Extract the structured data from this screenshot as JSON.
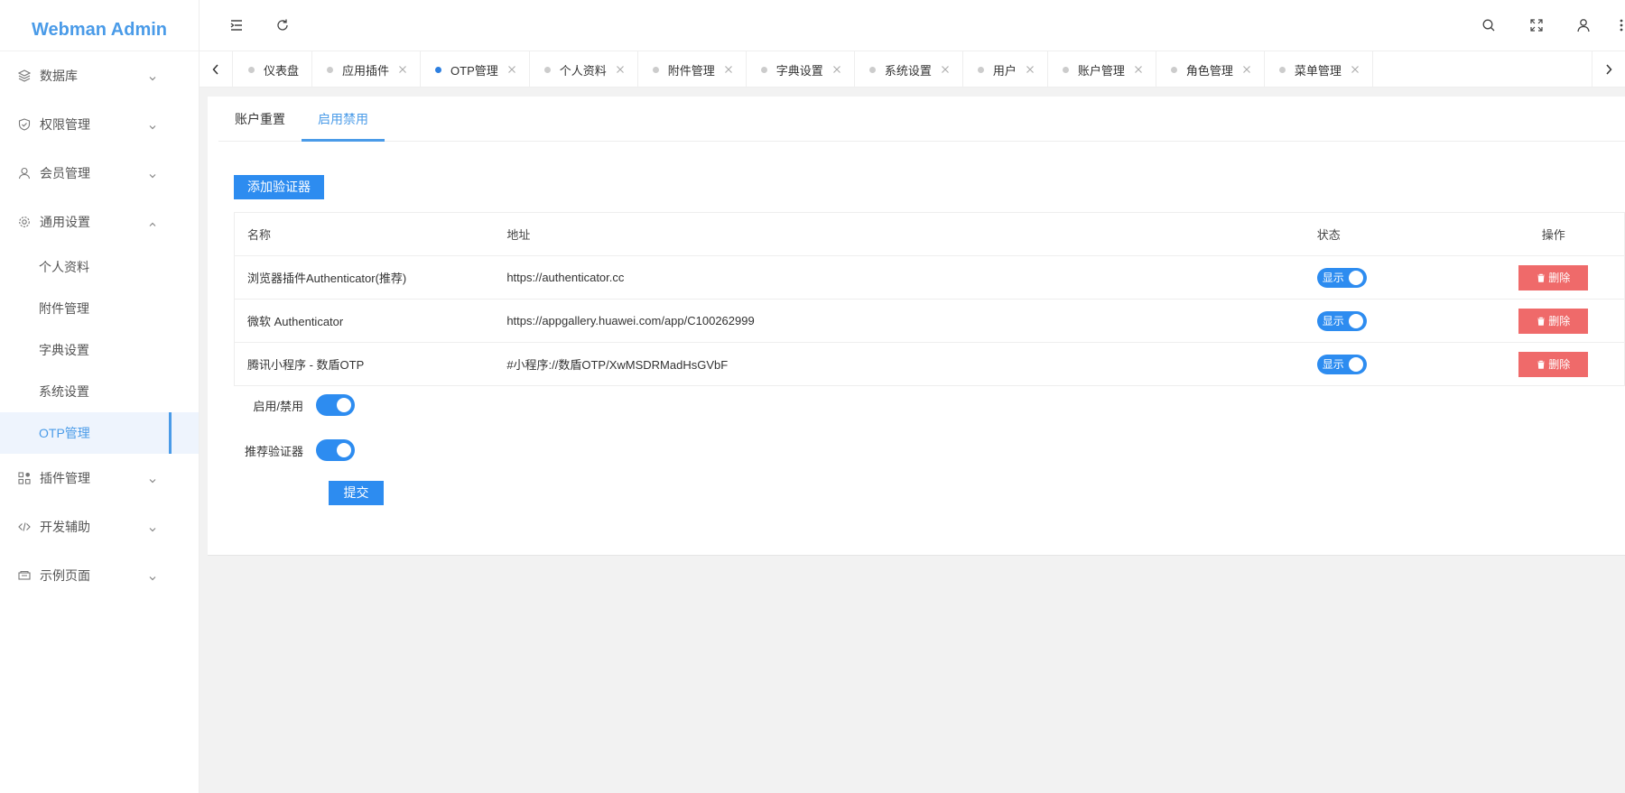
{
  "app": {
    "title": "Webman Admin"
  },
  "sidebar": {
    "items": [
      {
        "label": "数据库",
        "icon": "layers-icon"
      },
      {
        "label": "权限管理",
        "icon": "shield-icon"
      },
      {
        "label": "会员管理",
        "icon": "user-icon"
      },
      {
        "label": "通用设置",
        "icon": "gear-icon",
        "expanded": true,
        "children": [
          "个人资料",
          "附件管理",
          "字典设置",
          "系统设置",
          "OTP管理"
        ],
        "active_child": "OTP管理"
      },
      {
        "label": "插件管理",
        "icon": "apps-icon"
      },
      {
        "label": "开发辅助",
        "icon": "code-icon"
      },
      {
        "label": "示例页面",
        "icon": "page-icon"
      }
    ]
  },
  "header": {
    "icons": [
      "menu-fold-icon",
      "refresh-icon",
      "search-icon",
      "fullscreen-icon",
      "user-icon",
      "more-icon"
    ]
  },
  "tabs": [
    {
      "label": "仪表盘",
      "closable": false
    },
    {
      "label": "应用插件",
      "closable": true
    },
    {
      "label": "OTP管理",
      "closable": true,
      "active": true
    },
    {
      "label": "个人资料",
      "closable": true
    },
    {
      "label": "附件管理",
      "closable": true
    },
    {
      "label": "字典设置",
      "closable": true
    },
    {
      "label": "系统设置",
      "closable": true
    },
    {
      "label": "用户",
      "closable": true
    },
    {
      "label": "账户管理",
      "closable": true
    },
    {
      "label": "角色管理",
      "closable": true
    },
    {
      "label": "菜单管理",
      "closable": true
    }
  ],
  "content": {
    "subtabs": [
      "账户重置",
      "启用禁用"
    ],
    "active_subtab": "启用禁用",
    "add_button": "添加验证器",
    "table": {
      "headers": [
        "名称",
        "地址",
        "状态",
        "操作"
      ],
      "rows": [
        {
          "name": "浏览器插件Authenticator(推荐)",
          "url": "https://authenticator.cc",
          "status": "显示",
          "action": "删除"
        },
        {
          "name": "微软 Authenticator",
          "url": "https://appgallery.huawei.com/app/C100262999",
          "status": "显示",
          "action": "删除"
        },
        {
          "name": "腾讯小程序 - 数盾OTP",
          "url": "#小程序://数盾OTP/XwMSDRMadHsGVbF",
          "status": "显示",
          "action": "删除"
        }
      ]
    },
    "form": {
      "enable_label": "启用/禁用",
      "enable_on": true,
      "recommend_label": "推荐验证器",
      "recommend_on": true,
      "submit_label": "提交"
    }
  },
  "colors": {
    "primary": "#2d8cf0",
    "brand": "#4a9be8",
    "danger": "#ef6a6a"
  }
}
